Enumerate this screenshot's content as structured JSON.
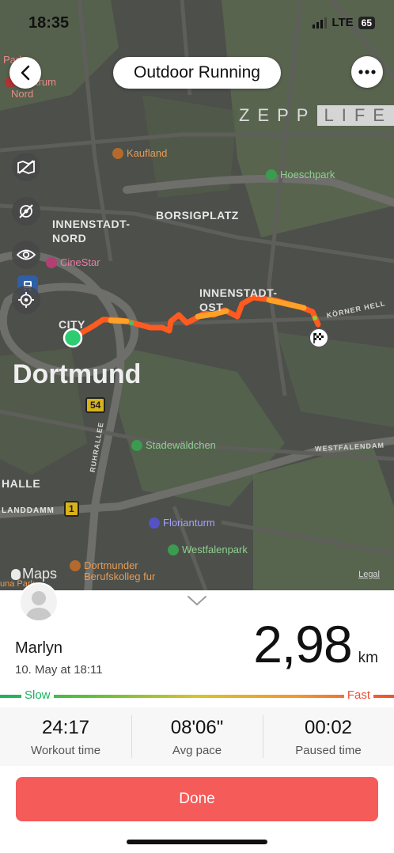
{
  "status_bar": {
    "time": "18:35",
    "network": "LTE",
    "battery": "65"
  },
  "header": {
    "title": "Outdoor Running",
    "brand_left": "ZEPP",
    "brand_right": "LIFE"
  },
  "map": {
    "labels": {
      "innenstadt_nord": "INNENSTADT-\nNORD",
      "borsigplatz": "BORSIGPLATZ",
      "innenstadt_ost": "INNENSTADT-\nOST",
      "city": "CITY",
      "dortmund": "Dortmund",
      "halle": "HALLE",
      "landdamm": "LANDDAMM",
      "korner": "KÖRNER HELL",
      "westfalendam": "WESTFALENDAM",
      "ruhrallee": "RUHRALLEE",
      "zentrum": "zentrum",
      "nord": "Nord",
      "park": "Park"
    },
    "pois": {
      "kaufland": "Kaufland",
      "hoeschpark": "Hoeschpark",
      "cinestar": "CineStar",
      "stadewaeldchen": "Stadewäldchen",
      "florianturm": "Florianturm",
      "westfalenpark": "Westfalenpark",
      "berufskolleg": "Dortmunder\nBerufskolleg fur",
      "una_park": "una Park"
    },
    "shields": {
      "b54": "54",
      "b1": "1"
    },
    "maps_brand": "Maps",
    "legal": "Legal",
    "route_colors": {
      "start": "#2ecc71",
      "fast": "#ff5a1f",
      "medium": "#ffa126"
    }
  },
  "workout": {
    "user_name": "Marlyn",
    "date": "10. May at 18:11",
    "distance": "2,98",
    "distance_unit": "km",
    "pace_slow_label": "Slow",
    "pace_fast_label": "Fast",
    "stats": [
      {
        "value": "24:17",
        "label": "Workout time"
      },
      {
        "value": "08'06\"",
        "label": "Avg pace"
      },
      {
        "value": "00:02",
        "label": "Paused time"
      }
    ],
    "done_label": "Done"
  },
  "icons": [
    "back-icon",
    "more-icon",
    "map-style-icon",
    "no-location-icon",
    "eye-icon",
    "locate-icon",
    "chevron-down-icon",
    "avatar-icon",
    "finish-flag-icon",
    "apple-logo-icon"
  ],
  "colors": {
    "accent": "#f55b59",
    "slow": "#19b35f",
    "fast": "#f04f37"
  }
}
